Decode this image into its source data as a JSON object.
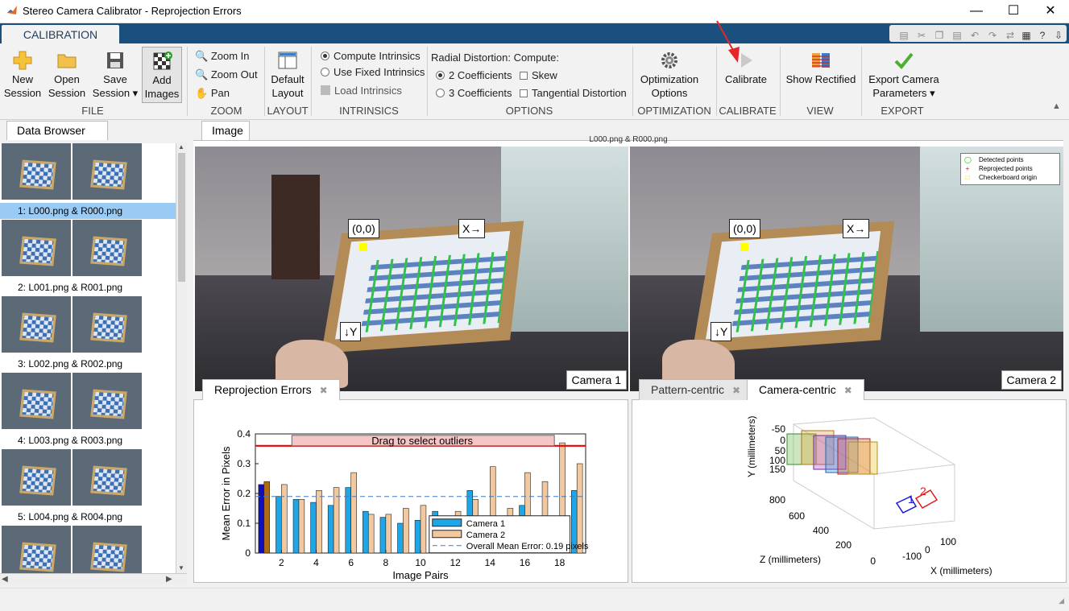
{
  "window": {
    "title": "Stereo Camera Calibrator - Reprojection Errors"
  },
  "tabs": {
    "calibration": "CALIBRATION"
  },
  "ribbon": {
    "file": {
      "new_session": "New\nSession",
      "open_session": "Open\nSession",
      "save_session": "Save\nSession ▾",
      "add_images": "Add\nImages",
      "label": "FILE"
    },
    "zoom": {
      "zoom_in": "Zoom In",
      "zoom_out": "Zoom Out",
      "pan": "Pan",
      "label": "ZOOM"
    },
    "layout": {
      "default_layout": "Default\nLayout",
      "label": "LAYOUT"
    },
    "intrinsics": {
      "compute": "COMPUTE INTRINSICS",
      "compute_label": "Compute Intrinsics",
      "use_fixed": "Use Fixed Intrinsics",
      "load": "Load Intrinsics",
      "label": "INTRINSICS"
    },
    "options": {
      "radial_title": "Radial Distortion:",
      "compute_title": "Compute:",
      "two_coeff": "2 Coefficients",
      "three_coeff": "3 Coefficients",
      "skew": "Skew",
      "tangential": "Tangential Distortion",
      "label": "OPTIONS"
    },
    "optimization": {
      "button": "Optimization\nOptions",
      "label": "OPTIMIZATION"
    },
    "calibrate": {
      "button": "Calibrate",
      "label": "CALIBRATE"
    },
    "view": {
      "button": "Show Rectified",
      "label": "VIEW"
    },
    "export": {
      "button": "Export Camera\nParameters ▾",
      "label": "EXPORT"
    }
  },
  "data_browser": {
    "title": "Data Browser",
    "items": [
      {
        "label": "1: L000.png & R000.png",
        "selected": true
      },
      {
        "label": "2: L001.png & R001.png",
        "selected": false
      },
      {
        "label": "3: L002.png & R002.png",
        "selected": false
      },
      {
        "label": "4: L003.png & R003.png",
        "selected": false
      },
      {
        "label": "5: L004.png & R004.png",
        "selected": false
      },
      {
        "label": "",
        "selected": false
      }
    ]
  },
  "image_panel": {
    "tab": "Image",
    "caption": "L000.png & R000.png",
    "camera1": "Camera 1",
    "camera2": "Camera 2",
    "origin": "(0,0)",
    "x_axis": "X→",
    "y_axis": "↓Y",
    "legend": [
      "Detected points",
      "Reprojected points",
      "Checkerboard origin"
    ],
    "legend_colors": [
      "#00c000",
      "#e0002a",
      "#ffff00"
    ]
  },
  "reprojection": {
    "tab": "Reprojection Errors",
    "drag_label": "Drag to select outliers"
  },
  "extrinsics": {
    "tab_pattern": "Pattern-centric",
    "tab_camera": "Camera-centric",
    "y_label": "Y (millimeters)",
    "z_label": "Z (millimeters)",
    "x_label": "X (millimeters)",
    "y_ticks": [
      "-50",
      "0",
      "50",
      "100",
      "150"
    ],
    "z_ticks": [
      "800",
      "600",
      "400",
      "200",
      "0"
    ],
    "x_ticks": [
      "-100",
      "0",
      "100"
    ],
    "cam_labels": [
      "1",
      "2"
    ]
  },
  "chart_data": {
    "type": "bar",
    "xlabel": "Image Pairs",
    "ylabel": "Mean Error in Pixels",
    "xlim": [
      0.5,
      19.5
    ],
    "ylim": [
      0,
      0.4
    ],
    "yticks": [
      0,
      0.1,
      0.2,
      0.3,
      0.4
    ],
    "xticks": [
      2,
      4,
      6,
      8,
      10,
      12,
      14,
      16,
      18
    ],
    "categories": [
      1,
      2,
      3,
      4,
      5,
      6,
      7,
      8,
      9,
      10,
      11,
      12,
      13,
      14,
      15,
      16,
      17,
      18,
      19
    ],
    "series": [
      {
        "name": "Camera 1",
        "color": "#1ea7e8",
        "values": [
          0.23,
          0.19,
          0.18,
          0.17,
          0.16,
          0.22,
          0.14,
          0.12,
          0.1,
          0.11,
          0.14,
          0.09,
          0.21,
          0.11,
          0.08,
          0.16,
          0.1,
          0.08,
          0.21
        ]
      },
      {
        "name": "Camera 2",
        "color": "#f2c8a0",
        "values": [
          0.24,
          0.23,
          0.18,
          0.21,
          0.22,
          0.27,
          0.13,
          0.13,
          0.15,
          0.16,
          0.12,
          0.14,
          0.18,
          0.29,
          0.15,
          0.27,
          0.24,
          0.37,
          0.3
        ]
      }
    ],
    "overall_mean": 0.19,
    "overall_label": "Overall Mean Error: 0.19 pixels",
    "threshold": 0.36,
    "selected_pair": 1
  }
}
